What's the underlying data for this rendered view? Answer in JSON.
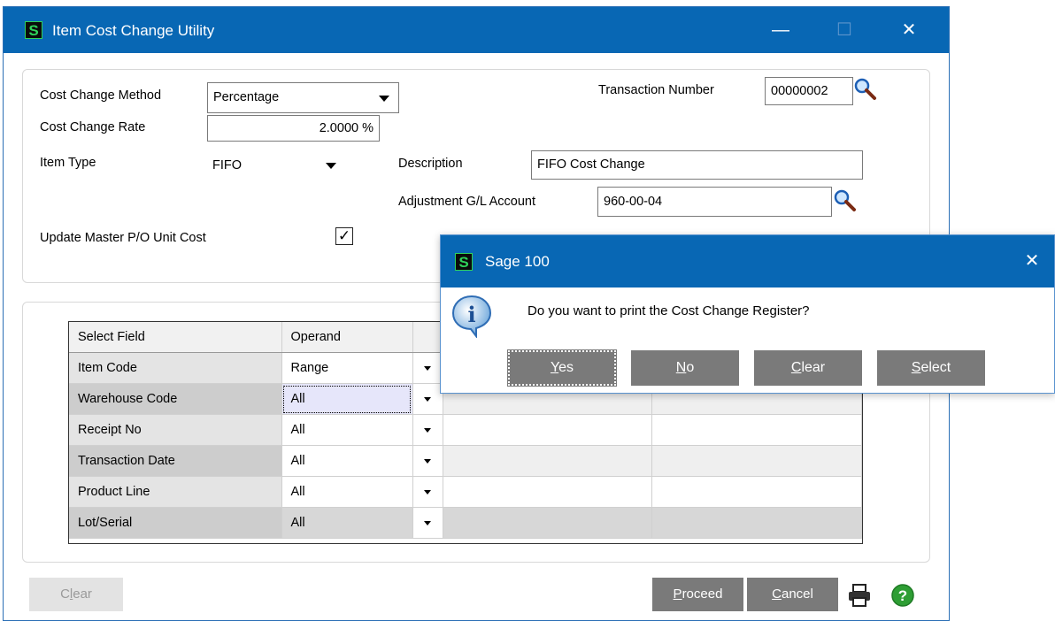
{
  "window": {
    "title": "Item Cost Change Utility",
    "logo_letter": "S",
    "controls": {
      "minimize": "—",
      "maximize": "☐",
      "close": "✕"
    }
  },
  "form": {
    "cost_change_method": {
      "label": "Cost Change Method",
      "value": "Percentage"
    },
    "cost_change_rate": {
      "label": "Cost Change Rate",
      "value": "2.0000 %"
    },
    "item_type": {
      "label": "Item Type",
      "value": "FIFO"
    },
    "update_master": {
      "label": "Update Master P/O Unit Cost",
      "checked": true,
      "check_glyph": "✓"
    },
    "transaction_number": {
      "label": "Transaction Number",
      "value": "00000002"
    },
    "description": {
      "label": "Description",
      "value": "FIFO Cost Change"
    },
    "adjustment_gl": {
      "label": "Adjustment G/L Account",
      "value": "960-00-04"
    }
  },
  "grid": {
    "headers": [
      "Select Field",
      "Operand"
    ],
    "rows": [
      {
        "field": "Item Code",
        "operand": "Range"
      },
      {
        "field": "Warehouse Code",
        "operand": "All"
      },
      {
        "field": "Receipt No",
        "operand": "All"
      },
      {
        "field": "Transaction Date",
        "operand": "All"
      },
      {
        "field": "Product Line",
        "operand": "All"
      },
      {
        "field": "Lot/Serial",
        "operand": "All"
      }
    ]
  },
  "footer": {
    "clear": {
      "prefix": "C",
      "hotkey": "l",
      "rest": "ear"
    },
    "proceed": {
      "prefix": "",
      "hotkey": "P",
      "rest": "roceed"
    },
    "cancel": {
      "prefix": "",
      "hotkey": "C",
      "rest": "ancel"
    }
  },
  "dialog": {
    "title": "Sage 100",
    "logo_letter": "S",
    "close": "✕",
    "info_glyph": "i",
    "message": "Do you want to print the Cost Change Register?",
    "buttons": [
      {
        "hotkey": "Y",
        "rest": "es"
      },
      {
        "hotkey": "N",
        "rest": "o"
      },
      {
        "hotkey": "C",
        "rest": "lear"
      },
      {
        "hotkey": "S",
        "rest": "elect"
      }
    ]
  },
  "colors": {
    "titlebar": "#0867b4",
    "button": "#7a7a7a",
    "logo_green": "#2fd35a",
    "help_green": "#2e9e34"
  }
}
